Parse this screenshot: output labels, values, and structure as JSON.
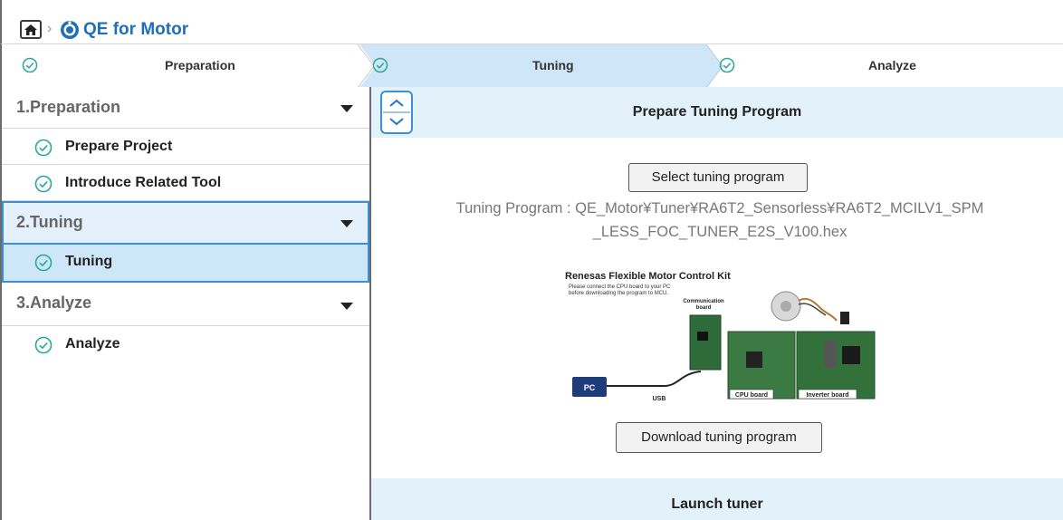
{
  "header": {
    "app_title": "QE for Motor",
    "home_icon": "home-icon",
    "logo_icon": "motor-logo-icon"
  },
  "steps": [
    {
      "label": "Preparation",
      "state": "done"
    },
    {
      "label": "Tuning",
      "state": "active"
    },
    {
      "label": "Analyze",
      "state": "pending"
    }
  ],
  "sidebar": {
    "sections": [
      {
        "title": "1.Preparation",
        "items": [
          {
            "label": "Prepare Project"
          },
          {
            "label": "Introduce Related Tool"
          }
        ]
      },
      {
        "title": "2.Tuning",
        "items": [
          {
            "label": "Tuning"
          }
        ]
      },
      {
        "title": "3.Analyze",
        "items": [
          {
            "label": "Analyze"
          }
        ]
      }
    ]
  },
  "main": {
    "section1_title": "Prepare Tuning Program",
    "select_button": "Select tuning program",
    "tuning_program_line1": "Tuning Program : QE_Motor¥Tuner¥RA6T2_Sensorless¥RA6T2_MCILV1_SPM",
    "tuning_program_line2": "_LESS_FOC_TUNER_E2S_V100.hex",
    "diagram": {
      "title": "Renesas Flexible Motor Control Kit",
      "note_line1": "Please connect the CPU board to your PC",
      "note_line2": "before downloading the program to MCU.",
      "comm_label1": "Communication",
      "comm_label2": "board",
      "pc_label": "PC",
      "usb_label": "USB",
      "cpu_label": "CPU board",
      "inverter_label": "Inverter board"
    },
    "download_button": "Download tuning program",
    "section2_title": "Launch tuner"
  },
  "colors": {
    "accent": "#3b8fd6",
    "active_bg": "#cde6f8",
    "band_bg": "#e3f1fb",
    "check_green": "#2aa79b",
    "title_blue": "#1f6fb8"
  }
}
